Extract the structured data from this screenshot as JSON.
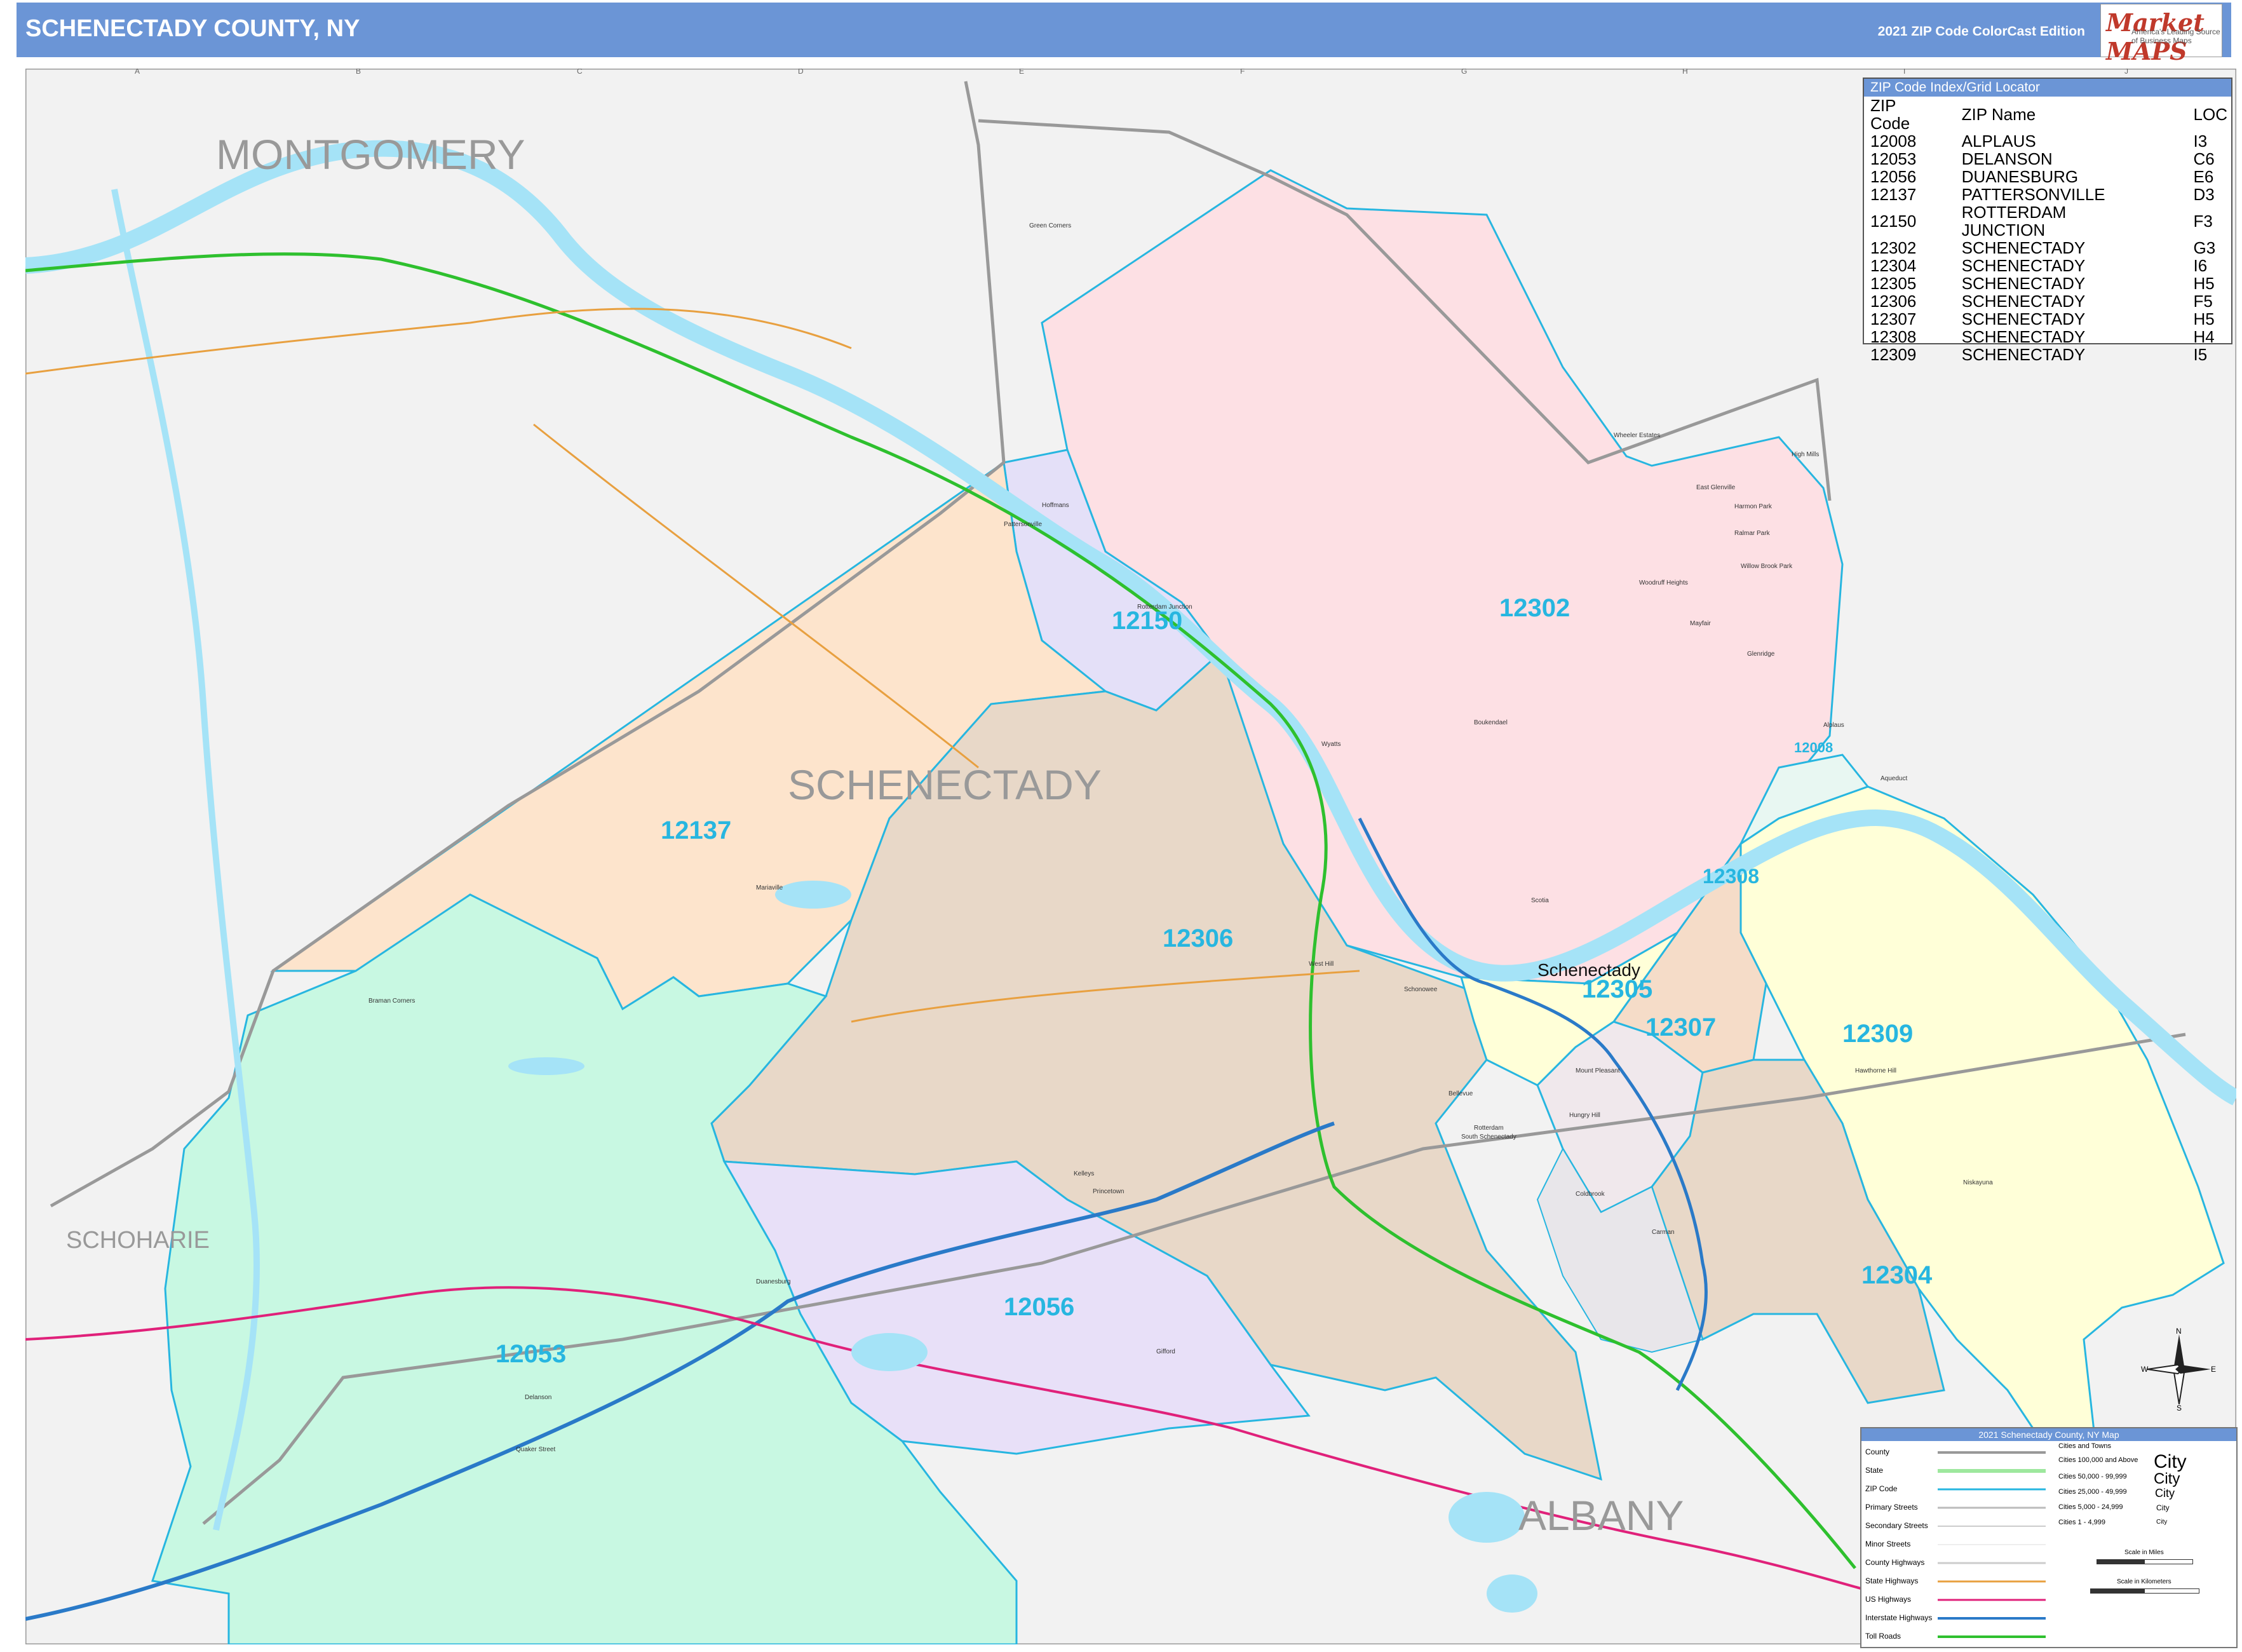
{
  "header": {
    "title": "SCHENECTADY COUNTY, NY",
    "edition": "2021 ZIP Code ColorCast Edition",
    "logo_text": "Market MAPS",
    "logo_tagline": "America's Leading Source of Business Maps"
  },
  "map_labels": {
    "counties": [
      "MONTGOMERY",
      "SCHENECTADY",
      "SCHOHARIE",
      "ALBANY"
    ],
    "zip_labels": [
      "12302",
      "12150",
      "12137",
      "12306",
      "12053",
      "12056",
      "12305",
      "12307",
      "12308",
      "12309",
      "12304",
      "12008"
    ],
    "city": "Schenectady",
    "places": [
      "Green Corners",
      "Hoffmans",
      "Pattersonville",
      "Rotterdam Junction",
      "Wheeler Estates",
      "High Mills",
      "East Glenville",
      "Harmon Park",
      "Ralmar Park",
      "Willow Brook Park",
      "Woodruff Heights",
      "Mayfair",
      "Glenridge",
      "Boukendael",
      "Wyatts",
      "Alplaus",
      "Aqueduct",
      "Scotia",
      "Mariaville",
      "Braman Corners",
      "West Hill",
      "Schonowee",
      "Mount Pleasant",
      "Bellevue",
      "Hungry Hill",
      "Rotterdam",
      "South Schenectady",
      "Kelleys",
      "Princetown",
      "Duanesburg",
      "Gifford",
      "Delanson",
      "Quaker Street",
      "Coldbrook",
      "Carman",
      "Niskayuna",
      "Hawthorne Hill"
    ],
    "grid_cols": [
      "A",
      "B",
      "C",
      "D",
      "E",
      "F",
      "G",
      "H",
      "I",
      "J"
    ],
    "grid_rows": [
      "1",
      "2",
      "3",
      "4",
      "5",
      "6",
      "7"
    ]
  },
  "zip_index": {
    "title": "ZIP Code Index/Grid Locator",
    "columns": [
      "ZIP Code",
      "ZIP Name",
      "LOC"
    ],
    "rows": [
      [
        "12008",
        "ALPLAUS",
        "I3"
      ],
      [
        "12053",
        "DELANSON",
        "C6"
      ],
      [
        "12056",
        "DUANESBURG",
        "E6"
      ],
      [
        "12137",
        "PATTERSONVILLE",
        "D3"
      ],
      [
        "12150",
        "ROTTERDAM JUNCTION",
        "F3"
      ],
      [
        "12302",
        "SCHENECTADY",
        "G3"
      ],
      [
        "12304",
        "SCHENECTADY",
        "I6"
      ],
      [
        "12305",
        "SCHENECTADY",
        "H5"
      ],
      [
        "12306",
        "SCHENECTADY",
        "F5"
      ],
      [
        "12307",
        "SCHENECTADY",
        "H5"
      ],
      [
        "12308",
        "SCHENECTADY",
        "H4"
      ],
      [
        "12309",
        "SCHENECTADY",
        "I5"
      ]
    ]
  },
  "legend": {
    "title": "2021 Schenectady County, NY Map",
    "items": [
      "County",
      "State",
      "ZIP Code",
      "Primary Streets",
      "Secondary Streets",
      "Minor Streets",
      "County Highways",
      "State Highways",
      "US Highways",
      "Interstate Highways",
      "Toll Roads"
    ],
    "cities_title": "Cities and Towns",
    "city_sizes": [
      "Cities 100,000 and Above",
      "Cities 50,000 - 99,999",
      "Cities 25,000 - 49,999",
      "Cities 5,000 - 24,999",
      "Cities 1 - 4,999"
    ],
    "city_sample": "City",
    "scale_miles": "Scale in Miles",
    "scale_km": "Scale in Kilometers"
  },
  "compass": {
    "n": "N",
    "s": "S",
    "e": "E",
    "w": "W"
  },
  "colors": {
    "header": "#6b95d6",
    "water": "#a5e3f7",
    "outside": "#f2f2f2",
    "zip_12302": "#fde0e4",
    "zip_12137": "#fde4cc",
    "zip_12306": "#e8d8c8",
    "zip_12053": "#c8f8e2",
    "zip_12056": "#e8e0f8",
    "zip_12309": "#ffffd8",
    "zip_12308": "#f5dcc8",
    "zip_12150": "#e4e0f8",
    "zip_label": "#27b6e0",
    "interstate": "#2a7ac8",
    "toll": "#2ec02e",
    "us_highway": "#e0217a",
    "state_highway": "#e8a040"
  }
}
